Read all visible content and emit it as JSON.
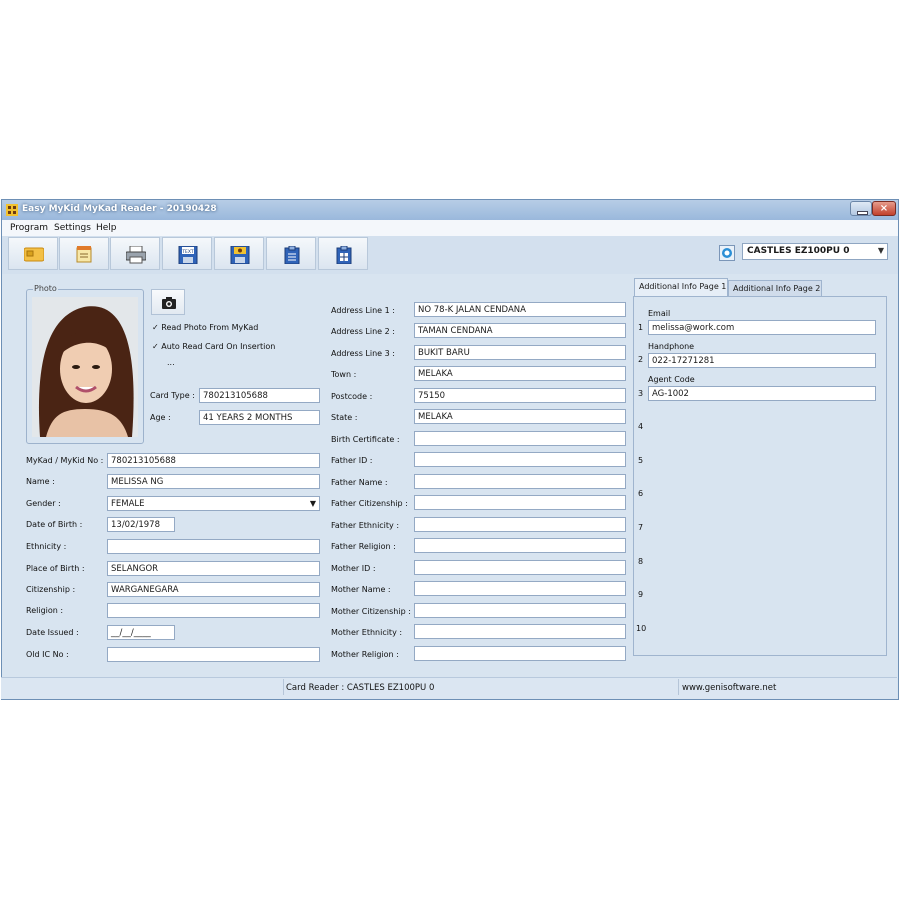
{
  "window": {
    "title": "Easy MyKid MyKad Reader - 20190428",
    "close_label": "×"
  },
  "menu": [
    "Program",
    "Settings",
    "Help"
  ],
  "toolbar": {
    "buttons": [
      {
        "name": "read-card-button",
        "icon": "smartcard-icon"
      },
      {
        "name": "edit-button",
        "icon": "notepad-icon"
      },
      {
        "name": "print-button",
        "icon": "printer-icon"
      },
      {
        "name": "save-text-button",
        "icon": "save-text-icon"
      },
      {
        "name": "save-image-button",
        "icon": "save-image-icon"
      },
      {
        "name": "export-button",
        "icon": "clipboard-icon"
      },
      {
        "name": "export-all-button",
        "icon": "clipboard-list-icon"
      }
    ],
    "reader_select": "CASTLES EZ100PU 0"
  },
  "photo_panel": {
    "legend": "Photo",
    "read_photo_label": "Read Photo From MyKad",
    "read_photo_checked": true,
    "auto_read_label": "Auto Read Card On Insertion",
    "auto_read_checked": true,
    "ellipsis": "...",
    "card_type_label": "Card Type :",
    "card_type_value": "780213105688",
    "age_label": "Age :",
    "age_value": "41 YEARS 2 MONTHS"
  },
  "personal": {
    "mykad_label": "MyKad / MyKid No :",
    "mykad_value": "780213105688",
    "name_label": "Name :",
    "name_value": "MELISSA NG",
    "gender_label": "Gender :",
    "gender_value": "FEMALE",
    "dob_label": "Date of Birth :",
    "dob_value": "13/02/1978",
    "ethnicity_label": "Ethnicity :",
    "ethnicity_value": "",
    "pob_label": "Place of Birth :",
    "pob_value": "SELANGOR",
    "citizenship_label": "Citizenship :",
    "citizenship_value": "WARGANEGARA",
    "religion_label": "Religion :",
    "religion_value": "",
    "date_issued_label": "Date Issued :",
    "date_issued_value": "__/__/____",
    "old_ic_label": "Old IC No :",
    "old_ic_value": ""
  },
  "address": {
    "line1_label": "Address Line 1 :",
    "line1_value": "NO 78-K JALAN CENDANA",
    "line2_label": "Address Line 2 :",
    "line2_value": "TAMAN CENDANA",
    "line3_label": "Address Line 3 :",
    "line3_value": "BUKIT BARU",
    "town_label": "Town :",
    "town_value": "MELAKA",
    "postcode_label": "Postcode :",
    "postcode_value": "75150",
    "state_label": "State :",
    "state_value": "MELAKA",
    "birth_cert_label": "Birth Certificate :",
    "birth_cert_value": "",
    "father_id_label": "Father ID :",
    "father_id_value": "",
    "father_name_label": "Father Name :",
    "father_name_value": "",
    "father_citizenship_label": "Father Citizenship :",
    "father_citizenship_value": "",
    "father_ethnicity_label": "Father Ethnicity :",
    "father_ethnicity_value": "",
    "father_religion_label": "Father Religion :",
    "father_religion_value": "",
    "mother_id_label": "Mother ID :",
    "mother_id_value": "",
    "mother_name_label": "Mother Name :",
    "mother_name_value": "",
    "mother_citizenship_label": "Mother Citizenship :",
    "mother_citizenship_value": "",
    "mother_ethnicity_label": "Mother Ethnicity :",
    "mother_ethnicity_value": "",
    "mother_religion_label": "Mother Religion :",
    "mother_religion_value": ""
  },
  "additional": {
    "tab1": "Additional Info Page 1",
    "tab2": "Additional Info Page 2",
    "rows": [
      {
        "num": "1",
        "label": "Email",
        "value": "melissa@work.com"
      },
      {
        "num": "2",
        "label": "Handphone",
        "value": "022-17271281"
      },
      {
        "num": "3",
        "label": "Agent Code",
        "value": "AG-1002"
      },
      {
        "num": "4"
      },
      {
        "num": "5"
      },
      {
        "num": "6"
      },
      {
        "num": "7"
      },
      {
        "num": "8"
      },
      {
        "num": "9"
      },
      {
        "num": "10"
      }
    ]
  },
  "status": {
    "card_reader": "Card Reader : CASTLES EZ100PU 0",
    "website": "www.genisoftware.net"
  },
  "colors": {
    "title_bar": "#9ab8dc",
    "window_bg": "#d8e4f0",
    "close_button": "#c2402c"
  }
}
